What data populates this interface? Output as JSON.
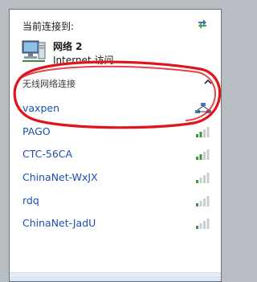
{
  "header": {
    "label": "当前连接到:"
  },
  "current_connection": {
    "name": "网络 2",
    "access": "Internet 访问"
  },
  "wireless_section": {
    "label": "无线网络连接"
  },
  "networks": [
    {
      "name": "vaxpen",
      "icon": "adhoc-network-icon"
    },
    {
      "name": "PAGO",
      "icon": "signal-bars-icon"
    },
    {
      "name": "CTC-56CA",
      "icon": "signal-bars-icon"
    },
    {
      "name": "ChinaNet-WxJX",
      "icon": "signal-bars-icon"
    },
    {
      "name": "rdq",
      "icon": "signal-bars-icon"
    },
    {
      "name": "ChinaNet-JadU",
      "icon": "signal-bars-icon"
    }
  ],
  "colors": {
    "link": "#1a4fb0",
    "annotation": "#e0141b",
    "panel_border": "#6a7180"
  }
}
